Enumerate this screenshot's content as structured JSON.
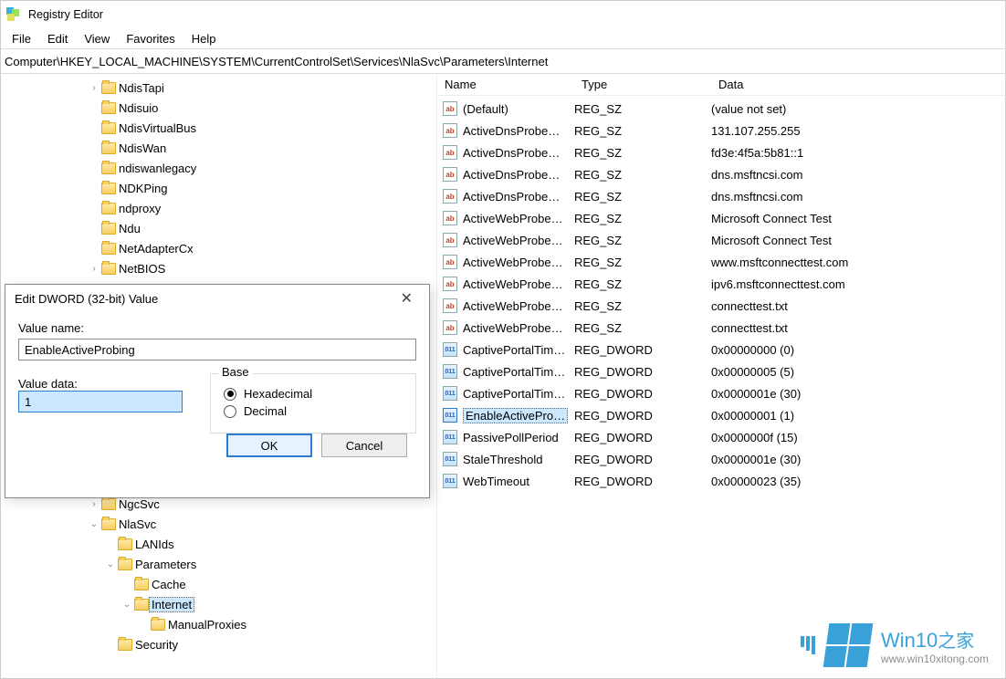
{
  "titlebar": {
    "title": "Registry Editor"
  },
  "menubar": {
    "file": "File",
    "edit": "Edit",
    "view": "View",
    "favorites": "Favorites",
    "help": "Help"
  },
  "addressbar": {
    "path": "Computer\\HKEY_LOCAL_MACHINE\\SYSTEM\\CurrentControlSet\\Services\\NlaSvc\\Parameters\\Internet"
  },
  "tree": {
    "items": [
      {
        "indent": 4,
        "arrow": ">",
        "label": "NdisTapi"
      },
      {
        "indent": 4,
        "arrow": "",
        "label": "Ndisuio"
      },
      {
        "indent": 4,
        "arrow": "",
        "label": "NdisVirtualBus"
      },
      {
        "indent": 4,
        "arrow": "",
        "label": "NdisWan"
      },
      {
        "indent": 4,
        "arrow": "",
        "label": "ndiswanlegacy"
      },
      {
        "indent": 4,
        "arrow": "",
        "label": "NDKPing"
      },
      {
        "indent": 4,
        "arrow": "",
        "label": "ndproxy"
      },
      {
        "indent": 4,
        "arrow": "",
        "label": "Ndu"
      },
      {
        "indent": 4,
        "arrow": "",
        "label": "NetAdapterCx"
      },
      {
        "indent": 4,
        "arrow": ">",
        "label": "NetBIOS"
      },
      {
        "indent": 4,
        "arrow": ">",
        "label": "NgcSvc"
      },
      {
        "indent": 4,
        "arrow": "v",
        "label": "NlaSvc"
      },
      {
        "indent": 5,
        "arrow": "",
        "label": "LANIds"
      },
      {
        "indent": 5,
        "arrow": "v",
        "label": "Parameters"
      },
      {
        "indent": 6,
        "arrow": "",
        "label": "Cache"
      },
      {
        "indent": 6,
        "arrow": "v",
        "label": "Internet",
        "selected": true
      },
      {
        "indent": 7,
        "arrow": "",
        "label": "ManualProxies"
      },
      {
        "indent": 5,
        "arrow": "",
        "label": "Security"
      }
    ]
  },
  "list": {
    "headers": {
      "name": "Name",
      "type": "Type",
      "data": "Data"
    },
    "rows": [
      {
        "icon": "sz",
        "name": "(Default)",
        "type": "REG_SZ",
        "data": "(value not set)"
      },
      {
        "icon": "sz",
        "name": "ActiveDnsProbe…",
        "type": "REG_SZ",
        "data": "131.107.255.255"
      },
      {
        "icon": "sz",
        "name": "ActiveDnsProbe…",
        "type": "REG_SZ",
        "data": "fd3e:4f5a:5b81::1"
      },
      {
        "icon": "sz",
        "name": "ActiveDnsProbe…",
        "type": "REG_SZ",
        "data": "dns.msftncsi.com"
      },
      {
        "icon": "sz",
        "name": "ActiveDnsProbe…",
        "type": "REG_SZ",
        "data": "dns.msftncsi.com"
      },
      {
        "icon": "sz",
        "name": "ActiveWebProbe…",
        "type": "REG_SZ",
        "data": "Microsoft Connect Test"
      },
      {
        "icon": "sz",
        "name": "ActiveWebProbe…",
        "type": "REG_SZ",
        "data": "Microsoft Connect Test"
      },
      {
        "icon": "sz",
        "name": "ActiveWebProbe…",
        "type": "REG_SZ",
        "data": "www.msftconnecttest.com"
      },
      {
        "icon": "sz",
        "name": "ActiveWebProbe…",
        "type": "REG_SZ",
        "data": "ipv6.msftconnecttest.com"
      },
      {
        "icon": "sz",
        "name": "ActiveWebProbe…",
        "type": "REG_SZ",
        "data": "connecttest.txt"
      },
      {
        "icon": "sz",
        "name": "ActiveWebProbe…",
        "type": "REG_SZ",
        "data": "connecttest.txt"
      },
      {
        "icon": "dw",
        "name": "CaptivePortalTim…",
        "type": "REG_DWORD",
        "data": "0x00000000 (0)"
      },
      {
        "icon": "dw",
        "name": "CaptivePortalTim…",
        "type": "REG_DWORD",
        "data": "0x00000005 (5)"
      },
      {
        "icon": "dw",
        "name": "CaptivePortalTim…",
        "type": "REG_DWORD",
        "data": "0x0000001e (30)"
      },
      {
        "icon": "dw",
        "name": "EnableActivePro…",
        "type": "REG_DWORD",
        "data": "0x00000001 (1)",
        "selected": true
      },
      {
        "icon": "dw",
        "name": "PassivePollPeriod",
        "type": "REG_DWORD",
        "data": "0x0000000f (15)"
      },
      {
        "icon": "dw",
        "name": "StaleThreshold",
        "type": "REG_DWORD",
        "data": "0x0000001e (30)"
      },
      {
        "icon": "dw",
        "name": "WebTimeout",
        "type": "REG_DWORD",
        "data": "0x00000023 (35)"
      }
    ]
  },
  "dialog": {
    "title": "Edit DWORD (32-bit) Value",
    "value_name_label": "Value name:",
    "value_name": "EnableActiveProbing",
    "value_data_label": "Value data:",
    "value_data": "1",
    "base_label": "Base",
    "hex_label": "Hexadecimal",
    "dec_label": "Decimal",
    "ok": "OK",
    "cancel": "Cancel"
  },
  "watermark": {
    "brand": "Win10",
    "brand_zh": "之家",
    "url": "www.win10xitong.com"
  }
}
